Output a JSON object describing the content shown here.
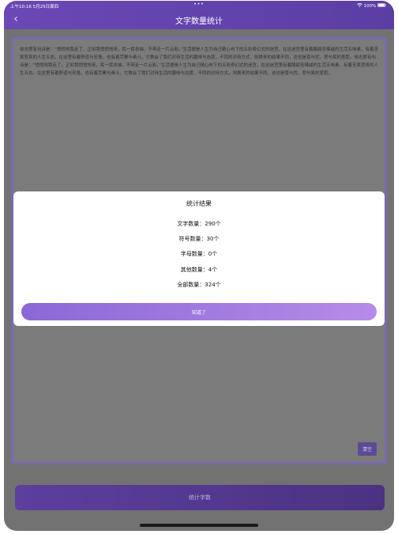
{
  "status_bar": {
    "time_date": "上午10:16  5月25日周四",
    "center_dots": "•••",
    "battery": "100%"
  },
  "nav": {
    "title": "文字数量统计",
    "back_icon": "chevron-left-icon"
  },
  "text_area": {
    "content": "徐志摩有句诗是：“悄悄地我走了，正如我悄悄地来，挥一挥衣袖，不带走一片云彩。”生活便是人生为自己精心布下的五彩奇幻式的迷宫，在这迷宫里有着酸甜苦辣咸的生活五味素，有着苦笑悲哀的人生五态。在这里有着舒适与安逸，也有着劳累与奋斗，它教会了我们对待生活的趣味与态度，不同的对待方式，则换来的结果不同，这也是喜与忧，悲与笑的差距。徐志摩有句诗是：“悄悄地我走了，正如我悄悄地来，挥一挥衣袖，不带走一片云彩。”生活便是人生为自己精心布下的五彩奇幻式的迷宫，在这迷宫里有着酸甜苦辣咸的生活五味素，有着苦笑悲哀的人生五态。在这里有着舒适与安逸，也有着劳累与奋斗，它教会了我们对待生活的趣味与态度，不同的对待方式，则换来的结果不同，这也是喜与忧，悲与笑的差距。",
    "clear_label": "清空"
  },
  "count_button_label": "统计字数",
  "modal": {
    "title": "统计结果",
    "stats": [
      "文字数量：290个",
      "符号数量：30个",
      "字母数量：0个",
      "其他数量：4个",
      "全部数量：324个"
    ],
    "ok_label": "知道了"
  },
  "colors": {
    "nav_purple": "#6a48b6",
    "ok_gradient_start": "#8a68d6",
    "ok_gradient_end": "#b78be8"
  }
}
